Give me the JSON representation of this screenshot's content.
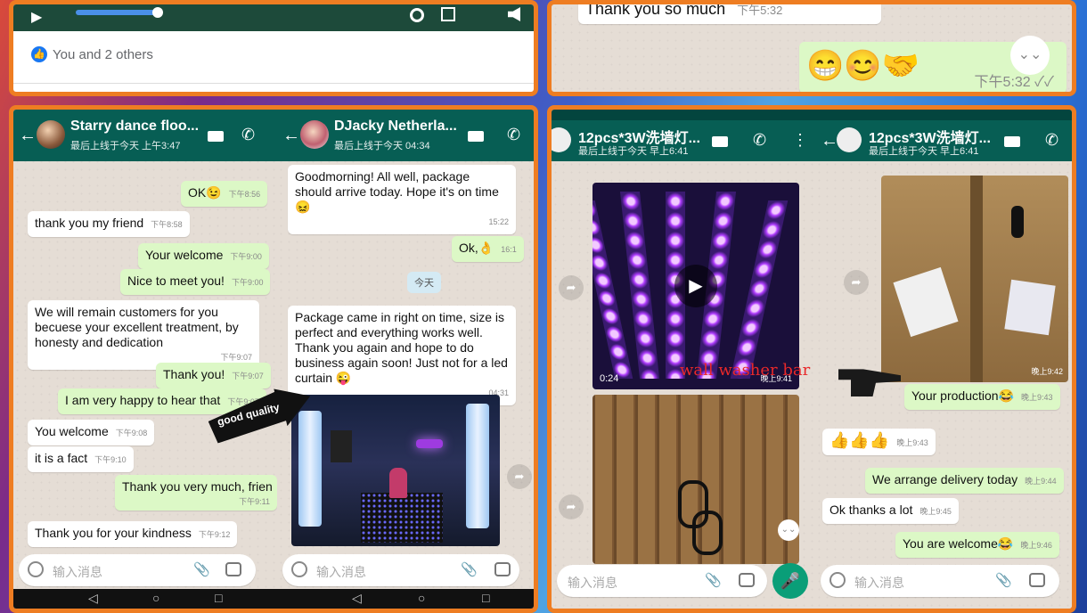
{
  "top_left": {
    "reaction_text": "You and 2 others"
  },
  "top_right": {
    "msg1": "Thank you so much",
    "msg1_time": "下午5:32",
    "emoji": "😁😊🤝",
    "emoji_time": "下午5:32 ✓✓"
  },
  "chat1": {
    "name": "Starry dance floo...",
    "status": "最后上线于今天 上午3:47",
    "messages": [
      {
        "text": "OK😉",
        "time": "下午8:56"
      },
      {
        "text": "thank you my friend",
        "time": "下午8:58"
      },
      {
        "text": "Your welcome",
        "time": "下午9:00"
      },
      {
        "text": "Nice to meet you!",
        "time": "下午9:00"
      },
      {
        "text": "We will remain customers for you becuese your excellent treatment, by honesty and dedication",
        "time": "下午9:07"
      },
      {
        "text": "Thank you!",
        "time": "下午9:07"
      },
      {
        "text": "I am very happy to hear that",
        "time": "下午9:07"
      },
      {
        "text": "You welcome",
        "time": "下午9:08"
      },
      {
        "text": "it is a fact",
        "time": "下午9:10"
      },
      {
        "text": "Thank you very much, frien",
        "time": "下午9:11"
      },
      {
        "text": "Thank you for your kindness",
        "time": "下午9:12"
      }
    ],
    "input_placeholder": "输入消息"
  },
  "chat2": {
    "name": "DJacky Netherla...",
    "status": "最后上线于今天 04:34",
    "messages": [
      {
        "text": "Goodmorning! All well, package should arrive today. Hope it's on time 😖",
        "time": "15:22"
      },
      {
        "text": "Ok,👌",
        "time": "16:1"
      },
      {
        "text": "今天",
        "time": ""
      },
      {
        "text": "Package came in right on time, size is perfect and everything works well. Thank you again and hope to do business again soon! Just not for a led curtain 😜",
        "time": "04:31"
      }
    ],
    "annotation": "good quality",
    "input_placeholder": "输入消息"
  },
  "chat3": {
    "name": "12pcs*3W洗墙灯...",
    "status": "最后上线于今天 早上6:41",
    "video_duration": "0:24",
    "video_time": "晚上9:41",
    "annotation": "wall washer bar",
    "input_placeholder": "输入消息"
  },
  "chat4": {
    "name": "12pcs*3W洗墙灯...",
    "status": "最后上线于今天 早上6:41",
    "image_time": "晚上9:42",
    "messages": [
      {
        "text": "Your production😂",
        "time": "晚上9:43"
      },
      {
        "text": "👍👍👍",
        "time": "晚上9:43"
      },
      {
        "text": "We arrange delivery today",
        "time": "晚上9:44"
      },
      {
        "text": "Ok thanks a lot",
        "time": "晚上9:45"
      },
      {
        "text": "You are welcome😂",
        "time": "晚上9:46"
      }
    ],
    "input_placeholder": "输入消息"
  },
  "nav": {
    "back": "◁",
    "home": "○",
    "recent": "□"
  },
  "icons": {
    "back": "←",
    "video": "■",
    "call": "✆",
    "clip": "📎",
    "mic": "🎤",
    "forward": "➦",
    "scroll": "⌄⌄",
    "play": "▶",
    "menu": "⋮"
  }
}
